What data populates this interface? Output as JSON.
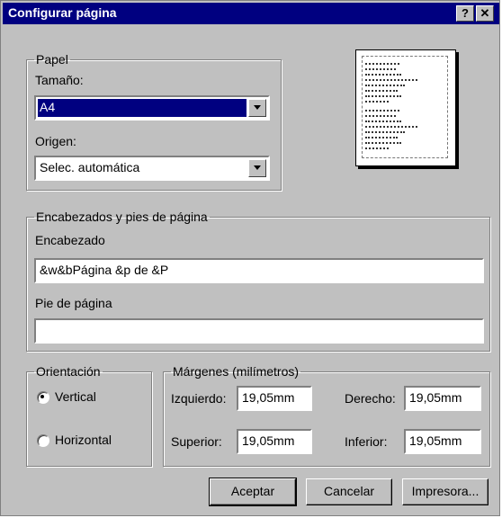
{
  "window": {
    "title": "Configurar página",
    "help_label": "?",
    "close_label": "✕"
  },
  "paper": {
    "group_label": "Papel",
    "size_label": "Tamaño:",
    "size_value": "A4",
    "source_label": "Origen:",
    "source_value": "Selec. automática"
  },
  "headers": {
    "group_label": "Encabezados y pies de página",
    "header_label": "Encabezado",
    "header_value": "&w&bPágina &p de &P",
    "footer_label": "Pie de página",
    "footer_value": ""
  },
  "orientation": {
    "group_label": "Orientación",
    "options": [
      {
        "label": "Vertical",
        "selected": true
      },
      {
        "label": "Horizontal",
        "selected": false
      }
    ]
  },
  "margins": {
    "group_label": "Márgenes (milímetros)",
    "left_label": "Izquierdo:",
    "left_value": "19,05mm",
    "right_label": "Derecho:",
    "right_value": "19,05mm",
    "top_label": "Superior:",
    "top_value": "19,05mm",
    "bottom_label": "Inferior:",
    "bottom_value": "19,05mm"
  },
  "buttons": {
    "ok": "Aceptar",
    "cancel": "Cancelar",
    "printer": "Impresora..."
  },
  "colors": {
    "titlebar": "#000080",
    "face": "#c0c0c0",
    "selection": "#000080"
  }
}
